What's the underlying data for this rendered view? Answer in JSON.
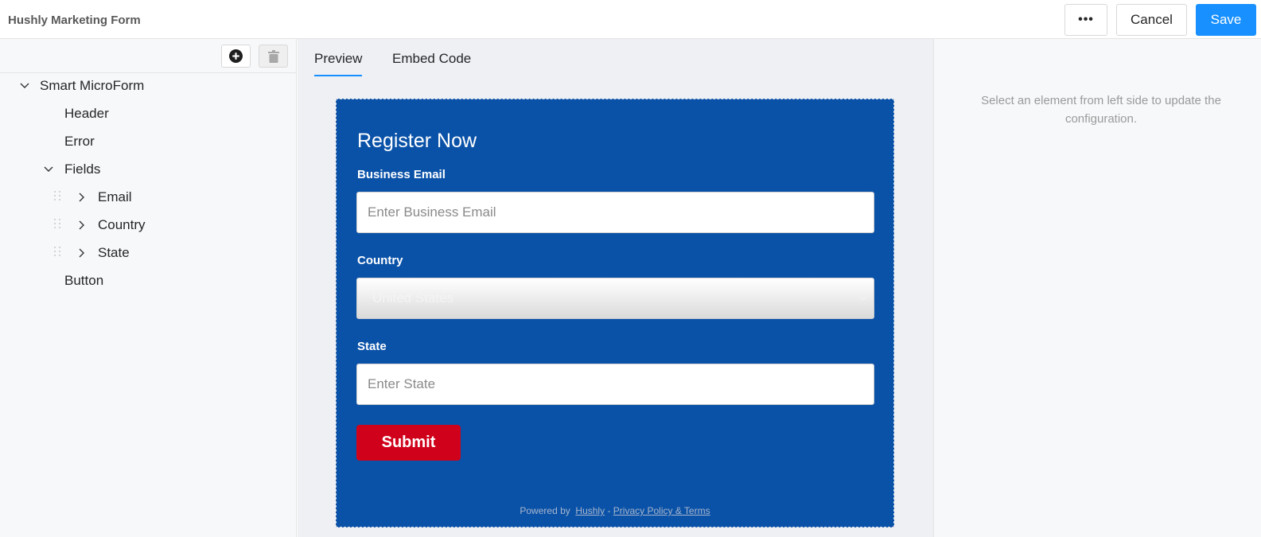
{
  "app": {
    "title": "Hushly Marketing Form"
  },
  "toolbar": {
    "more_label": "•••",
    "cancel_label": "Cancel",
    "save_label": "Save"
  },
  "tree": {
    "root": "Smart MicroForm",
    "header": "Header",
    "error": "Error",
    "fields": "Fields",
    "email": "Email",
    "country": "Country",
    "state": "State",
    "button": "Button"
  },
  "tabs": {
    "preview": "Preview",
    "embed": "Embed Code"
  },
  "form": {
    "title": "Register Now",
    "email_label": "Business Email",
    "email_placeholder": "Enter Business Email",
    "country_label": "Country",
    "country_value": "United States",
    "state_label": "State",
    "state_placeholder": "Enter State",
    "submit_label": "Submit",
    "powered_prefix": "Powered by",
    "powered_brand": "Hushly",
    "powered_sep": "-",
    "powered_link": "Privacy Policy & Terms"
  },
  "right": {
    "message": "Select an element from left side to update the configuration."
  },
  "colors": {
    "accent": "#1890ff",
    "form_bg": "#0a52a8",
    "submit_bg": "#d0021b"
  }
}
